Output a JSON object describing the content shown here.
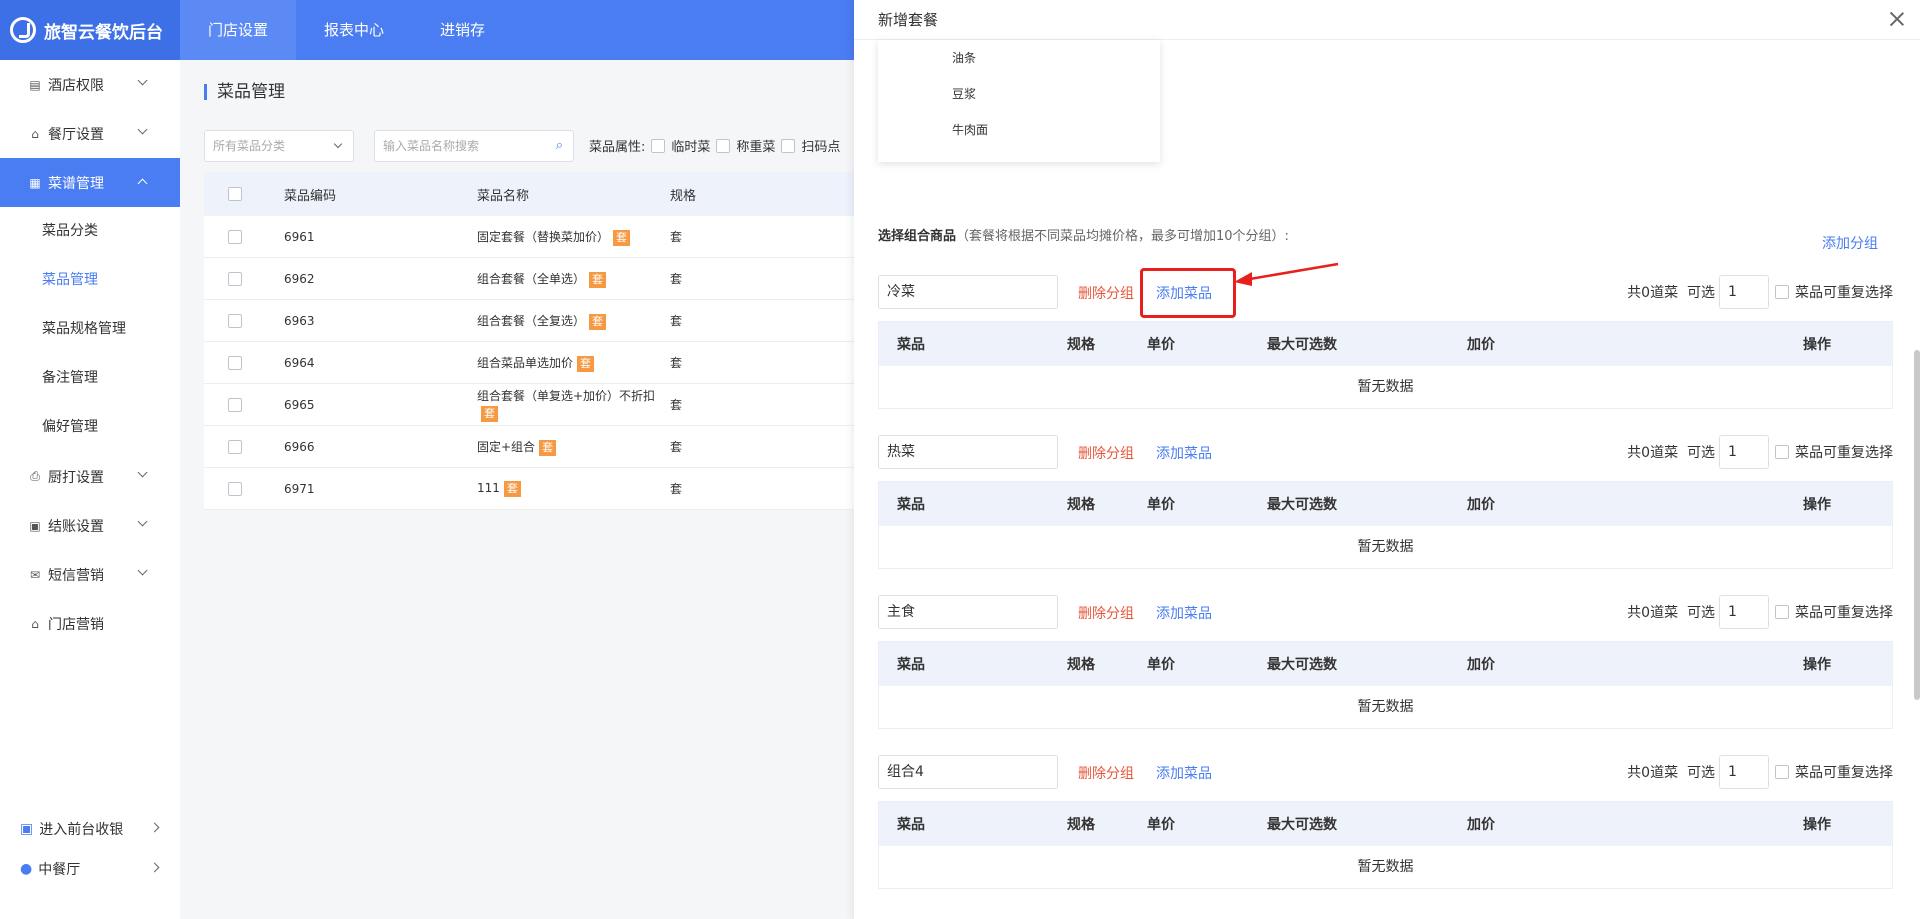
{
  "app": {
    "title": "旅智云餐饮后台"
  },
  "nav": [
    "门店设置",
    "报表中心",
    "进销存"
  ],
  "sidebar": {
    "items": [
      {
        "label": "酒店权限",
        "icon": "hotel-icon"
      },
      {
        "label": "餐厅设置",
        "icon": "restaurant-icon"
      },
      {
        "label": "菜谱管理",
        "icon": "grid-icon"
      }
    ],
    "sub": [
      "菜品分类",
      "菜品管理",
      "菜品规格管理",
      "备注管理",
      "偏好管理"
    ],
    "more": [
      {
        "label": "厨打设置",
        "icon": "printer-icon"
      },
      {
        "label": "结账设置",
        "icon": "checkout-icon"
      },
      {
        "label": "短信营销",
        "icon": "mail-icon"
      },
      {
        "label": "门店营销",
        "icon": "shop-icon"
      }
    ],
    "bottom": [
      "进入前台收银",
      "中餐厅"
    ]
  },
  "main": {
    "title": "菜品管理",
    "category_placeholder": "所有菜品分类",
    "search_placeholder": "输入菜品名称搜索",
    "attr_label": "菜品属性:",
    "attrs": [
      "临时菜",
      "称重菜",
      "扫码点"
    ],
    "headers": [
      "菜品编码",
      "菜品名称",
      "规格"
    ],
    "rows": [
      {
        "code": "6961",
        "name": "固定套餐（替换菜加价）",
        "tag": "套",
        "spec": "套"
      },
      {
        "code": "6962",
        "name": "组合套餐（全单选）",
        "tag": "套",
        "spec": "套"
      },
      {
        "code": "6963",
        "name": "组合套餐（全复选）",
        "tag": "套",
        "spec": "套"
      },
      {
        "code": "6964",
        "name": "组合菜品单选加价",
        "tag": "套",
        "spec": "套"
      },
      {
        "code": "6965",
        "name": "组合套餐（单复选+加价）不折扣",
        "tag": "套",
        "spec": "套"
      },
      {
        "code": "6966",
        "name": "固定+组合",
        "tag": "套",
        "spec": "套"
      },
      {
        "code": "6971",
        "name": "111",
        "tag": "套",
        "spec": "套"
      }
    ]
  },
  "drawer": {
    "title": "新增套餐",
    "dropdown_items": [
      "油条",
      "豆浆",
      "牛肉面"
    ],
    "select_label": "选择组合商品",
    "select_hint": "（套餐将根据不同菜品均摊价格，最多可增加10个分组）:",
    "add_group": "添加分组",
    "delete_group": "删除分组",
    "add_dish": "添加菜品",
    "count_text": "共0道菜",
    "optional_label": "可选",
    "optional_value": "1",
    "repeat_label": "菜品可重复选择",
    "table_headers": [
      "菜品",
      "规格",
      "单价",
      "最大可选数",
      "加价",
      "操作"
    ],
    "empty": "暂无数据",
    "groups": [
      "冷菜",
      "热菜",
      "主食",
      "组合4"
    ]
  }
}
